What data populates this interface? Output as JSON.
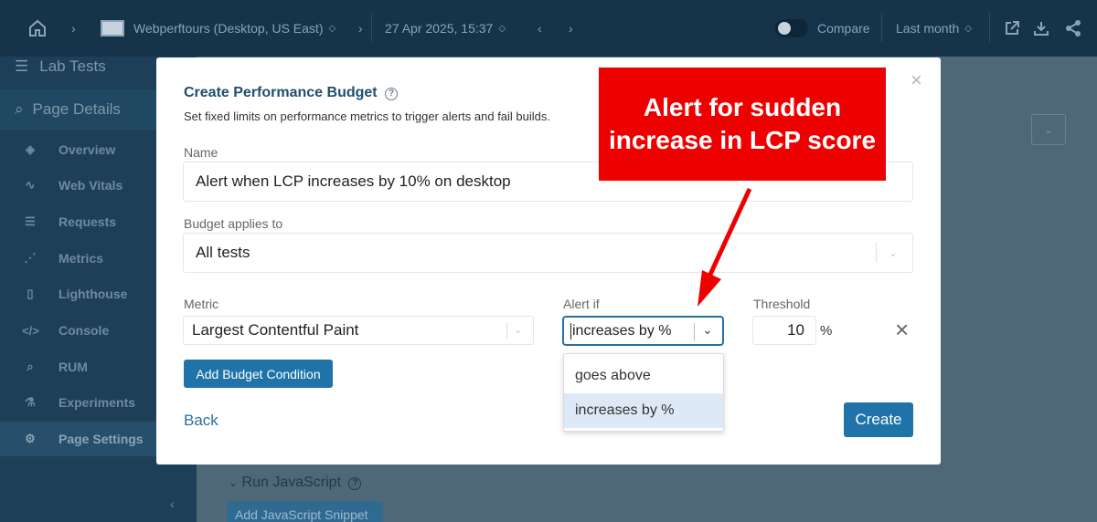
{
  "topbar": {
    "site_selector": "Webperftours (Desktop, US East)",
    "date_selector": "27 Apr 2025, 15:37",
    "compare_label": "Compare",
    "range_label": "Last month"
  },
  "sidebar": {
    "sections": [
      {
        "label": "Lab Tests",
        "icon": "list-icon"
      },
      {
        "label": "Page Details",
        "icon": "search-page-icon"
      }
    ],
    "items": [
      {
        "label": "Overview",
        "icon": "layers-icon"
      },
      {
        "label": "Web Vitals",
        "icon": "pulse-icon"
      },
      {
        "label": "Requests",
        "icon": "list-icon"
      },
      {
        "label": "Metrics",
        "icon": "chart-icon"
      },
      {
        "label": "Lighthouse",
        "icon": "lighthouse-icon"
      },
      {
        "label": "Console",
        "icon": "code-icon"
      },
      {
        "label": "RUM",
        "icon": "rum-icon"
      },
      {
        "label": "Experiments",
        "icon": "flask-icon"
      },
      {
        "label": "Page Settings",
        "icon": "gear-icon"
      }
    ]
  },
  "background": {
    "run_js_label": "Run JavaScript",
    "add_snippet_label": "Add JavaScript Snippet"
  },
  "modal": {
    "title": "Create Performance Budget",
    "subtitle": "Set fixed limits on performance metrics to trigger alerts and fail builds.",
    "name_label": "Name",
    "name_value": "Alert when LCP increases by 10% on desktop",
    "applies_label": "Budget applies to",
    "applies_value": "All tests",
    "metric_label": "Metric",
    "metric_value": "Largest Contentful Paint",
    "alertif_label": "Alert if",
    "alertif_value": "increases by %",
    "threshold_label": "Threshold",
    "threshold_value": "10",
    "threshold_unit": "%",
    "add_condition_label": "Add Budget Condition",
    "back_label": "Back",
    "create_label": "Create"
  },
  "dropdown": {
    "options": [
      "goes above",
      "increases by %"
    ],
    "selected": "increases by %"
  },
  "callout": {
    "text": "Alert for sudden increase in LCP score"
  },
  "colors": {
    "primary": "#1f73a8",
    "callout": "#ee0000",
    "modal_title": "#1f4e6e"
  }
}
